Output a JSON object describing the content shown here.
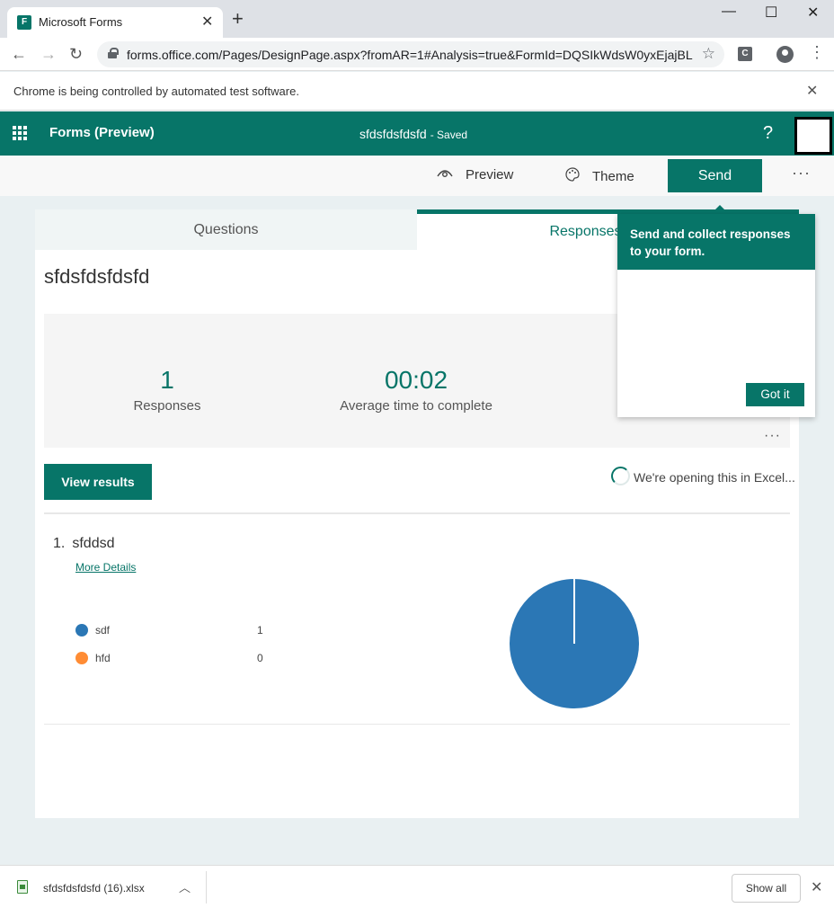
{
  "browser": {
    "tab_title": "Microsoft Forms",
    "url": "forms.office.com/Pages/DesignPage.aspx?fromAR=1#Analysis=true&FormId=DQSIkWdsW0yxEjajBL...",
    "ext_label": "C",
    "infobar_text": "Chrome is being controlled by automated test software."
  },
  "forms_header": {
    "app_name": "Forms (Preview)",
    "form_title": "sfdsfdsfdsfd",
    "saved": "- Saved",
    "help": "?"
  },
  "toolbar": {
    "preview_label": "Preview",
    "theme_label": "Theme",
    "send_label": "Send",
    "more": "···"
  },
  "tabs": {
    "questions": "Questions",
    "responses": "Responses"
  },
  "main": {
    "form_title": "sfdsfdsfdsfd",
    "stats": {
      "responses_value": "1",
      "responses_label": "Responses",
      "avg_time_value": "00:02",
      "avg_time_label": "Average time to complete",
      "more": "···"
    },
    "view_results_label": "View results",
    "excel_status": "We're opening this in Excel...",
    "question": {
      "number": "1.",
      "title": "sfddsd",
      "more_details": "More Details",
      "options": [
        {
          "label": "sdf",
          "count": "1",
          "color": "#2b77b5"
        },
        {
          "label": "hfd",
          "count": "0",
          "color": "#ff8c34"
        }
      ]
    }
  },
  "chart_data": {
    "type": "pie",
    "categories": [
      "sdf",
      "hfd"
    ],
    "values": [
      1,
      0
    ],
    "colors": [
      "#2b77b5",
      "#ff8c34"
    ]
  },
  "popup": {
    "message": "Send and collect responses to your form.",
    "button_label": "Got it"
  },
  "download_shelf": {
    "file_name": "sfdsfdsfdsfd (16).xlsx",
    "show_all_label": "Show all"
  },
  "colors": {
    "accent": "#077568",
    "series_1": "#2b77b5",
    "series_2": "#ff8c34"
  }
}
